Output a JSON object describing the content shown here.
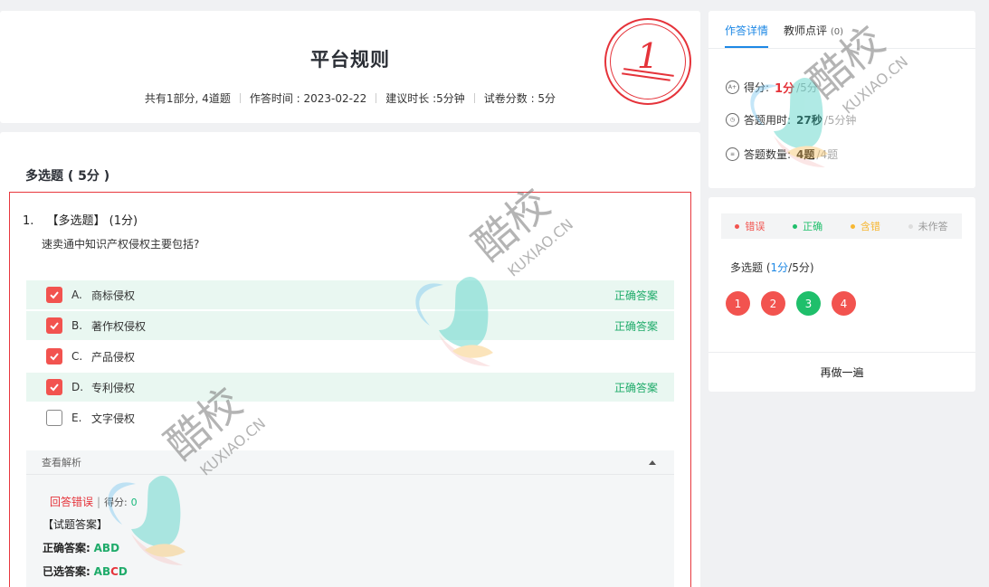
{
  "paper": {
    "title": "平台规则",
    "meta": [
      "共有1部分, 4道题",
      "作答时间 : 2023-02-22",
      "建议时长 :5分钟",
      "试卷分数 : 5分"
    ],
    "score_stamp": "1"
  },
  "section": {
    "title": "多选题 ( 5分 )"
  },
  "question": {
    "number": "1.",
    "type_label": "【多选题】 (1分)",
    "text": "速卖通中知识产权侵权主要包括?",
    "options": [
      {
        "letter": "A.",
        "text": "商标侵权",
        "checked": true,
        "tag": "正确答案"
      },
      {
        "letter": "B.",
        "text": "著作权侵权",
        "checked": true,
        "tag": "正确答案"
      },
      {
        "letter": "C.",
        "text": "产品侵权",
        "checked": true,
        "tag": ""
      },
      {
        "letter": "D.",
        "text": "专利侵权",
        "checked": true,
        "tag": "正确答案"
      },
      {
        "letter": "E.",
        "text": "文字侵权",
        "checked": false,
        "tag": ""
      }
    ],
    "analysis": {
      "toggle_label": "查看解析",
      "status": "回答错误",
      "score_label": "得分:",
      "score_value": "0",
      "answer_heading": "【试题答案】",
      "correct_label": "正确答案:",
      "correct_value": "ABD",
      "selected_label": "已选答案:",
      "selected_value": [
        "A",
        "B",
        "C",
        "D"
      ]
    }
  },
  "details": {
    "tabs": [
      {
        "label": "作答详情",
        "active": true
      },
      {
        "label": "教师点评",
        "count": "(0)"
      }
    ],
    "score": {
      "label": "得分:",
      "value": "1分",
      "total": "/5分"
    },
    "time": {
      "label": "答题用时:",
      "value": "27秒",
      "total": "/5分钟"
    },
    "count": {
      "label": "答题数量:",
      "value": "4题",
      "total": "/4题"
    }
  },
  "sheet": {
    "legend": [
      {
        "label": "错误",
        "color": "#f2534f"
      },
      {
        "label": "正确",
        "color": "#1fbf6b"
      },
      {
        "label": "含错",
        "color": "#f7b733"
      },
      {
        "label": "未作答",
        "color": "#dddddd"
      }
    ],
    "section_label": "多选题",
    "section_score": "1分",
    "section_total": "/5分)",
    "numbers": [
      {
        "n": "1",
        "color": "#f2534f"
      },
      {
        "n": "2",
        "color": "#f2534f"
      },
      {
        "n": "3",
        "color": "#1fbf6b"
      },
      {
        "n": "4",
        "color": "#f2534f"
      }
    ],
    "redo_label": "再做一遍"
  },
  "watermark": {
    "text": "酷校",
    "sub": "KUXIAO.CN"
  }
}
